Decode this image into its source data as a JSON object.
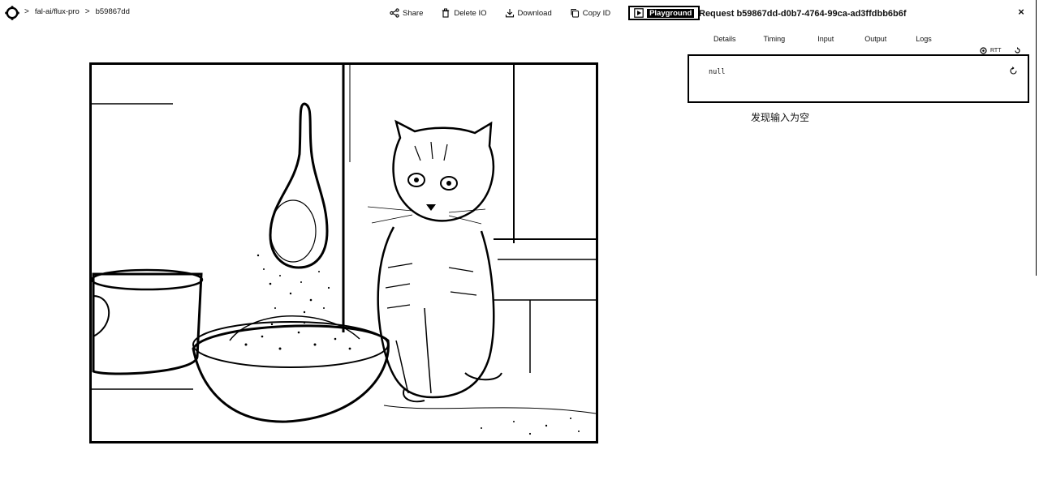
{
  "breadcrumb": {
    "items": [
      "fal-ai/flux-pro",
      "b59867dd"
    ],
    "separator": ">"
  },
  "toolbar": {
    "share_label": "Share",
    "delete_label": "Delete IO",
    "download_label": "Download",
    "copy_id_label": "Copy ID",
    "playground_label": "Playground"
  },
  "main_image": {
    "description_icon": "generated-image"
  },
  "panel": {
    "request_title": "Request b59867dd-d0b7-4764-99ca-ad3ffdbb6b6f",
    "close_label": "×",
    "tabs": [
      {
        "label": "Details"
      },
      {
        "label": "Timing"
      },
      {
        "label": "Input"
      },
      {
        "label": "Output"
      },
      {
        "label": "Logs"
      }
    ],
    "tools_label": "RTT",
    "output_value": "null",
    "note": "发现输入为空"
  },
  "colors": {
    "ink": "#000000",
    "background": "#ffffff"
  }
}
